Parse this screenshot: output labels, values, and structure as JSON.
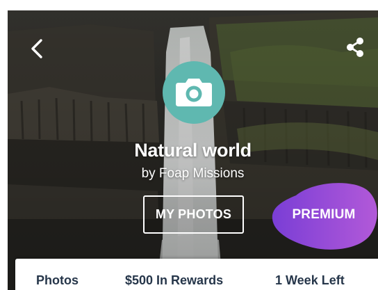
{
  "header": {
    "back_icon": "chevron-left-icon",
    "share_icon": "share-icon"
  },
  "mission": {
    "badge_icon": "camera-icon",
    "badge_color": "#5fb8b0",
    "title": "Natural world",
    "byline": "by Foap Missions"
  },
  "actions": {
    "my_photos_label": "MY PHOTOS",
    "premium_label": "PREMIUM",
    "premium_colors": [
      "#7a3ed6",
      "#b259d8"
    ]
  },
  "stats": {
    "photos_label": "Photos",
    "rewards_label": "$500 In Rewards",
    "time_left_label": "1 Week Left",
    "text_color": "#26364a"
  }
}
